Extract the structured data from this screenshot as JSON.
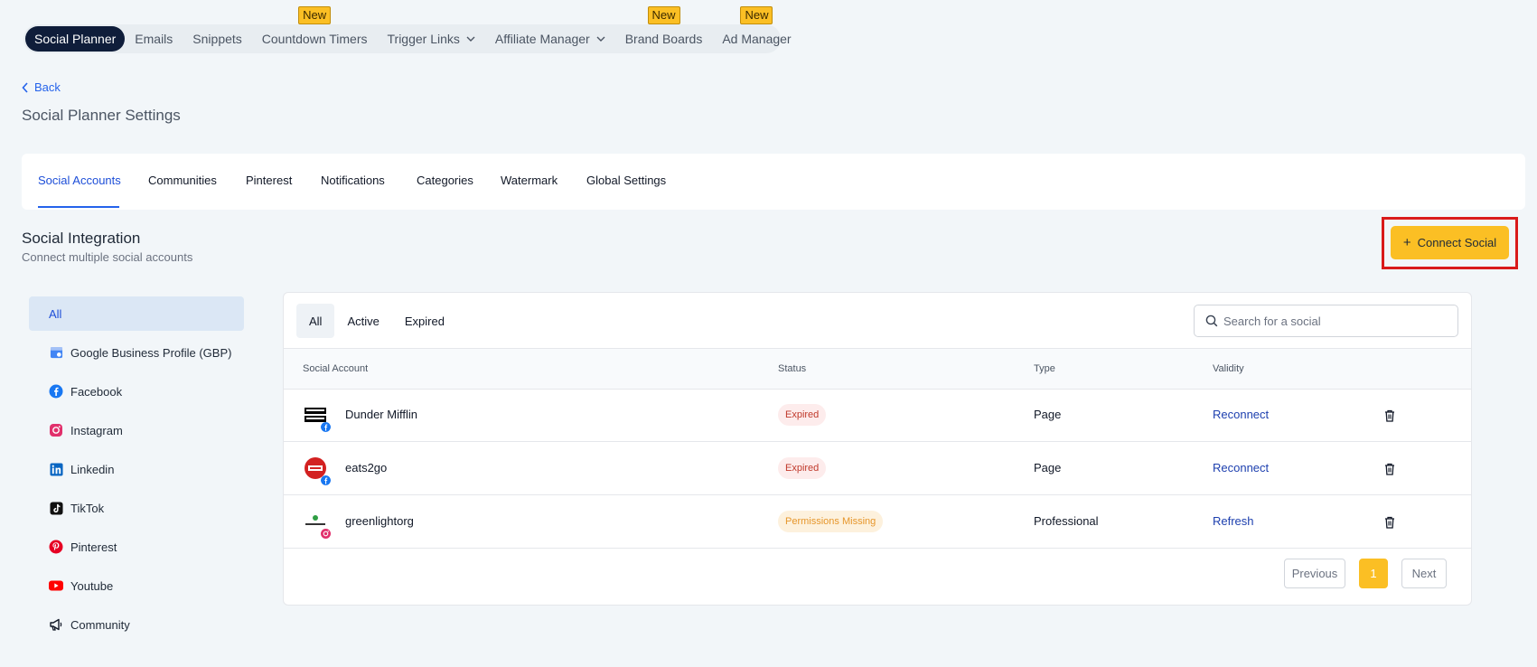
{
  "topnav": {
    "items": [
      {
        "label": "Social Planner",
        "badge": ""
      },
      {
        "label": "Emails",
        "badge": ""
      },
      {
        "label": "Snippets",
        "badge": ""
      },
      {
        "label": "Countdown Timers",
        "badge": "New"
      },
      {
        "label": "Trigger Links",
        "badge": ""
      },
      {
        "label": "Affiliate Manager",
        "badge": ""
      },
      {
        "label": "Brand Boards",
        "badge": "New"
      },
      {
        "label": "Ad Manager",
        "badge": "New"
      }
    ]
  },
  "back_label": "Back",
  "page_title": "Social Planner Settings",
  "tabs": [
    "Social Accounts",
    "Communities",
    "Pinterest",
    "Notifications",
    "Categories",
    "Watermark",
    "Global Settings"
  ],
  "section": {
    "title": "Social Integration",
    "subtitle": "Connect multiple social accounts",
    "connect_button": "Connect Social"
  },
  "sidebar": {
    "items": [
      {
        "label": "All",
        "icon": ""
      },
      {
        "label": "Google Business Profile (GBP)",
        "icon": "gbp-icon"
      },
      {
        "label": "Facebook",
        "icon": "facebook-icon"
      },
      {
        "label": "Instagram",
        "icon": "instagram-icon"
      },
      {
        "label": "Linkedin",
        "icon": "linkedin-icon"
      },
      {
        "label": "TikTok",
        "icon": "tiktok-icon"
      },
      {
        "label": "Pinterest",
        "icon": "pinterest-icon"
      },
      {
        "label": "Youtube",
        "icon": "youtube-icon"
      },
      {
        "label": "Community",
        "icon": "megaphone-icon"
      }
    ]
  },
  "filters": [
    "All",
    "Active",
    "Expired"
  ],
  "search": {
    "placeholder": "Search for a social"
  },
  "table": {
    "headers": [
      "Social Account",
      "Status",
      "Type",
      "Validity"
    ],
    "rows": [
      {
        "name": "Dunder Mifflin",
        "status": "Expired",
        "type": "Page",
        "validity": "Reconnect",
        "network": "facebook"
      },
      {
        "name": "eats2go",
        "status": "Expired",
        "type": "Page",
        "validity": "Reconnect",
        "network": "facebook"
      },
      {
        "name": "greenlightorg",
        "status": "Permissions Missing",
        "type": "Professional",
        "validity": "Refresh",
        "network": "instagram"
      }
    ]
  },
  "pagination": {
    "previous": "Previous",
    "page": "1",
    "next": "Next"
  },
  "colors": {
    "accent": "#fbbf24",
    "link": "#1e40af",
    "nav_active": "#0f1d3a",
    "highlight": "#d91a1a"
  }
}
